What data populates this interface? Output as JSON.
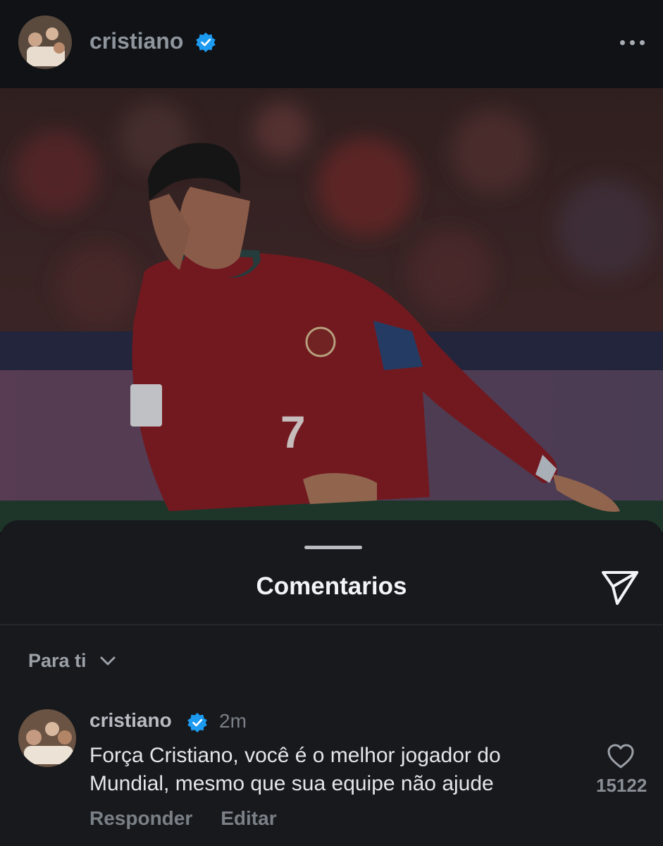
{
  "header": {
    "username": "cristiano",
    "verified_icon": "verified-badge-icon",
    "more_icon": "more-options-icon"
  },
  "post": {
    "image_icon": "post-photo"
  },
  "comments_sheet": {
    "title": "Comentarios",
    "share_icon": "send-icon",
    "filter_label": "Para ti",
    "filter_icon": "chevron-down-icon"
  },
  "comment": {
    "username": "cristiano",
    "time": "2m",
    "text": "Força Cristiano, você é o melhor jogador do Mundial, mesmo que sua equipe não ajude",
    "like_count": "15122",
    "reply_label": "Responder",
    "edit_label": "Editar"
  },
  "colors": {
    "verified": "#1d9bf0",
    "background": "#101216",
    "sheet": "#17191d"
  }
}
